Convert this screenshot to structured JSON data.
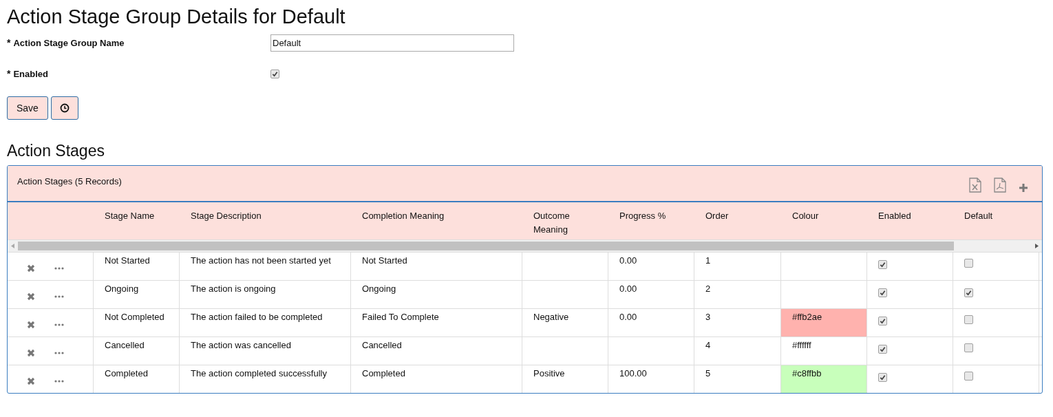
{
  "title": "Action Stage Group Details for Default",
  "form": {
    "fields": [
      {
        "kind": "text",
        "required_mark": "*",
        "label": "Action Stage Group Name",
        "value": "Default"
      },
      {
        "kind": "checkbox",
        "required_mark": "*",
        "label": "Enabled",
        "checked": true
      }
    ]
  },
  "buttons": [
    {
      "kind": "text",
      "label": "Save"
    },
    {
      "kind": "history"
    }
  ],
  "section_title": "Action Stages",
  "grid": {
    "caption": "Action Stages (5 Records)",
    "columns": [
      "Stage Name",
      "Stage Description",
      "Completion Meaning",
      "Outcome Meaning",
      "Progress %",
      "Order",
      "Colour",
      "Enabled",
      "Default"
    ],
    "rows": [
      {
        "stage_name": "Not Started",
        "description": "The action has not been started yet",
        "completion": "Not Started",
        "outcome": "",
        "progress": "0.00",
        "order": "1",
        "colour": "",
        "enabled": true,
        "default": false
      },
      {
        "stage_name": "Ongoing",
        "description": "The action is ongoing",
        "completion": "Ongoing",
        "outcome": "",
        "progress": "0.00",
        "order": "2",
        "colour": "",
        "enabled": true,
        "default": true
      },
      {
        "stage_name": "Not Completed",
        "description": "The action failed to be completed",
        "completion": "Failed To Complete",
        "outcome": "Negative",
        "progress": "0.00",
        "order": "3",
        "colour": "#ffb2ae",
        "color": "#ffb2ae",
        "enabled": true,
        "default": false
      },
      {
        "stage_name": "Cancelled",
        "description": "The action was cancelled",
        "completion": "Cancelled",
        "outcome": "",
        "progress": "",
        "order": "4",
        "colour": "#ffffff",
        "color": "#ffffff",
        "enabled": true,
        "default": false
      },
      {
        "stage_name": "Completed",
        "description": "The action completed successfully",
        "completion": "Completed",
        "outcome": "Positive",
        "progress": "100.00",
        "order": "5",
        "colour": "#c8ffbb",
        "color": "#c8ffbb",
        "enabled": true,
        "default": false
      }
    ]
  }
}
